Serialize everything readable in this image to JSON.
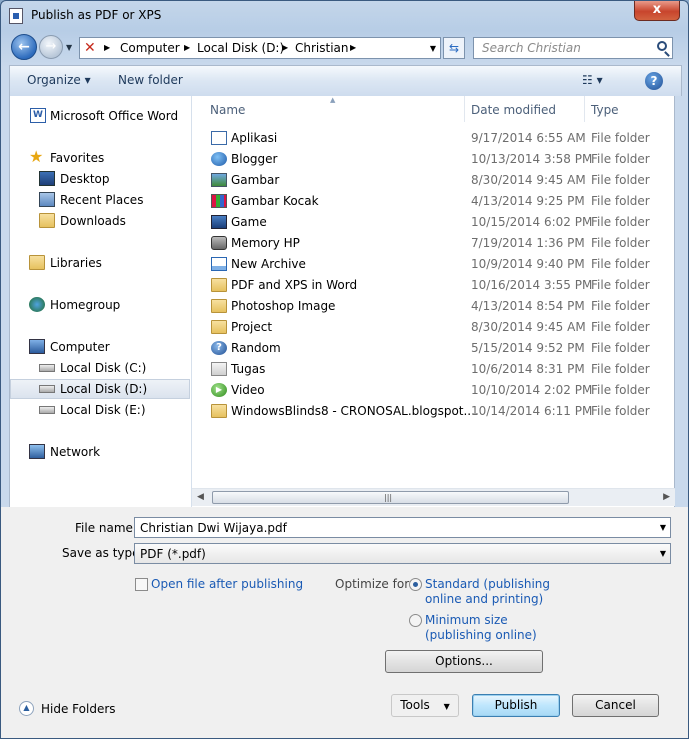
{
  "window": {
    "title": "Publish as PDF or XPS",
    "close": "x"
  },
  "nav": {
    "breadcrumbs": [
      "Computer",
      "Local Disk (D:)",
      "Christian"
    ],
    "search_placeholder": "Search Christian"
  },
  "toolbar": {
    "organize": "Organize ▾",
    "new_folder": "New folder",
    "views": "☷ ▾",
    "help": "?"
  },
  "sidebar": {
    "items": [
      {
        "label": "Microsoft Office Word",
        "icon": "word-icon"
      },
      {
        "label": "Favorites",
        "icon": "star-icon"
      },
      {
        "label": "Desktop",
        "icon": "desktop-icon"
      },
      {
        "label": "Recent Places",
        "icon": "recent-places-icon"
      },
      {
        "label": "Downloads",
        "icon": "downloads-icon"
      },
      {
        "label": "Libraries",
        "icon": "libraries-icon"
      },
      {
        "label": "Homegroup",
        "icon": "homegroup-icon"
      },
      {
        "label": "Computer",
        "icon": "computer-icon"
      },
      {
        "label": "Local Disk (C:)",
        "icon": "drive-icon"
      },
      {
        "label": "Local Disk (D:)",
        "icon": "drive-icon"
      },
      {
        "label": "Local Disk (E:)",
        "icon": "drive-icon"
      },
      {
        "label": "Network",
        "icon": "network-icon"
      }
    ]
  },
  "files": {
    "columns": {
      "name": "Name",
      "date": "Date modified",
      "type": "Type"
    },
    "rows": [
      {
        "name": "Aplikasi",
        "date": "9/17/2014 6:55 AM",
        "type": "File folder",
        "icon": "window-folder-icon"
      },
      {
        "name": "Blogger",
        "date": "10/13/2014 3:58 PM",
        "type": "File folder",
        "icon": "globe-folder-icon"
      },
      {
        "name": "Gambar",
        "date": "8/30/2014 9:45 AM",
        "type": "File folder",
        "icon": "picture-folder-icon"
      },
      {
        "name": "Gambar Kocak",
        "date": "4/13/2014 9:25 PM",
        "type": "File folder",
        "icon": "picture-grid-folder-icon"
      },
      {
        "name": "Game",
        "date": "10/15/2014 6:02 PM",
        "type": "File folder",
        "icon": "game-folder-icon"
      },
      {
        "name": "Memory HP",
        "date": "7/19/2014 1:36 PM",
        "type": "File folder",
        "icon": "phone-folder-icon"
      },
      {
        "name": "New Archive",
        "date": "10/9/2014 9:40 PM",
        "type": "File folder",
        "icon": "archive-folder-icon"
      },
      {
        "name": "PDF and XPS in Word",
        "date": "10/16/2014 3:55 PM",
        "type": "File folder",
        "icon": "folder-icon"
      },
      {
        "name": "Photoshop Image",
        "date": "4/13/2014 8:54 PM",
        "type": "File folder",
        "icon": "folder-icon"
      },
      {
        "name": "Project",
        "date": "8/30/2014 9:45 AM",
        "type": "File folder",
        "icon": "folder-icon"
      },
      {
        "name": "Random",
        "date": "5/15/2014 9:52 PM",
        "type": "File folder",
        "icon": "help-folder-icon"
      },
      {
        "name": "Tugas",
        "date": "10/6/2014 8:31 PM",
        "type": "File folder",
        "icon": "document-folder-icon"
      },
      {
        "name": "Video",
        "date": "10/10/2014 2:02 PM",
        "type": "File folder",
        "icon": "play-folder-icon"
      },
      {
        "name": "WindowsBlinds8 - CRONOSAL.blogspot....",
        "date": "10/14/2014 6:11 PM",
        "type": "File folder",
        "icon": "folder-icon"
      }
    ]
  },
  "form": {
    "file_name_label": "File name:",
    "file_name_value": "Christian Dwi Wijaya.pdf",
    "save_type_label": "Save as type:",
    "save_type_value": "PDF (*.pdf)",
    "open_after_label": "Open file after publishing",
    "optimize_label": "Optimize for:",
    "standard_line1": "Standard (publishing",
    "standard_line2": "online and printing)",
    "minimum_line1": "Minimum size",
    "minimum_line2": "(publishing online)",
    "options_button": "Options...",
    "hide_folders": "Hide Folders",
    "tools_button": "Tools",
    "publish_button": "Publish",
    "cancel_button": "Cancel"
  }
}
